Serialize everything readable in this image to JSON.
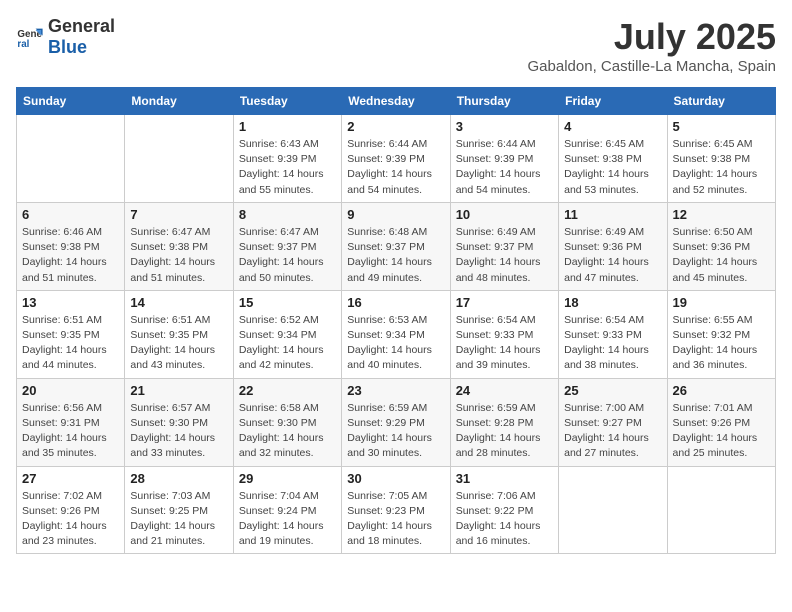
{
  "header": {
    "logo_general": "General",
    "logo_blue": "Blue",
    "month": "July 2025",
    "location": "Gabaldon, Castille-La Mancha, Spain"
  },
  "weekdays": [
    "Sunday",
    "Monday",
    "Tuesday",
    "Wednesday",
    "Thursday",
    "Friday",
    "Saturday"
  ],
  "weeks": [
    [
      {
        "day": "",
        "sunrise": "",
        "sunset": "",
        "daylight": ""
      },
      {
        "day": "",
        "sunrise": "",
        "sunset": "",
        "daylight": ""
      },
      {
        "day": "1",
        "sunrise": "Sunrise: 6:43 AM",
        "sunset": "Sunset: 9:39 PM",
        "daylight": "Daylight: 14 hours and 55 minutes."
      },
      {
        "day": "2",
        "sunrise": "Sunrise: 6:44 AM",
        "sunset": "Sunset: 9:39 PM",
        "daylight": "Daylight: 14 hours and 54 minutes."
      },
      {
        "day": "3",
        "sunrise": "Sunrise: 6:44 AM",
        "sunset": "Sunset: 9:39 PM",
        "daylight": "Daylight: 14 hours and 54 minutes."
      },
      {
        "day": "4",
        "sunrise": "Sunrise: 6:45 AM",
        "sunset": "Sunset: 9:38 PM",
        "daylight": "Daylight: 14 hours and 53 minutes."
      },
      {
        "day": "5",
        "sunrise": "Sunrise: 6:45 AM",
        "sunset": "Sunset: 9:38 PM",
        "daylight": "Daylight: 14 hours and 52 minutes."
      }
    ],
    [
      {
        "day": "6",
        "sunrise": "Sunrise: 6:46 AM",
        "sunset": "Sunset: 9:38 PM",
        "daylight": "Daylight: 14 hours and 51 minutes."
      },
      {
        "day": "7",
        "sunrise": "Sunrise: 6:47 AM",
        "sunset": "Sunset: 9:38 PM",
        "daylight": "Daylight: 14 hours and 51 minutes."
      },
      {
        "day": "8",
        "sunrise": "Sunrise: 6:47 AM",
        "sunset": "Sunset: 9:37 PM",
        "daylight": "Daylight: 14 hours and 50 minutes."
      },
      {
        "day": "9",
        "sunrise": "Sunrise: 6:48 AM",
        "sunset": "Sunset: 9:37 PM",
        "daylight": "Daylight: 14 hours and 49 minutes."
      },
      {
        "day": "10",
        "sunrise": "Sunrise: 6:49 AM",
        "sunset": "Sunset: 9:37 PM",
        "daylight": "Daylight: 14 hours and 48 minutes."
      },
      {
        "day": "11",
        "sunrise": "Sunrise: 6:49 AM",
        "sunset": "Sunset: 9:36 PM",
        "daylight": "Daylight: 14 hours and 47 minutes."
      },
      {
        "day": "12",
        "sunrise": "Sunrise: 6:50 AM",
        "sunset": "Sunset: 9:36 PM",
        "daylight": "Daylight: 14 hours and 45 minutes."
      }
    ],
    [
      {
        "day": "13",
        "sunrise": "Sunrise: 6:51 AM",
        "sunset": "Sunset: 9:35 PM",
        "daylight": "Daylight: 14 hours and 44 minutes."
      },
      {
        "day": "14",
        "sunrise": "Sunrise: 6:51 AM",
        "sunset": "Sunset: 9:35 PM",
        "daylight": "Daylight: 14 hours and 43 minutes."
      },
      {
        "day": "15",
        "sunrise": "Sunrise: 6:52 AM",
        "sunset": "Sunset: 9:34 PM",
        "daylight": "Daylight: 14 hours and 42 minutes."
      },
      {
        "day": "16",
        "sunrise": "Sunrise: 6:53 AM",
        "sunset": "Sunset: 9:34 PM",
        "daylight": "Daylight: 14 hours and 40 minutes."
      },
      {
        "day": "17",
        "sunrise": "Sunrise: 6:54 AM",
        "sunset": "Sunset: 9:33 PM",
        "daylight": "Daylight: 14 hours and 39 minutes."
      },
      {
        "day": "18",
        "sunrise": "Sunrise: 6:54 AM",
        "sunset": "Sunset: 9:33 PM",
        "daylight": "Daylight: 14 hours and 38 minutes."
      },
      {
        "day": "19",
        "sunrise": "Sunrise: 6:55 AM",
        "sunset": "Sunset: 9:32 PM",
        "daylight": "Daylight: 14 hours and 36 minutes."
      }
    ],
    [
      {
        "day": "20",
        "sunrise": "Sunrise: 6:56 AM",
        "sunset": "Sunset: 9:31 PM",
        "daylight": "Daylight: 14 hours and 35 minutes."
      },
      {
        "day": "21",
        "sunrise": "Sunrise: 6:57 AM",
        "sunset": "Sunset: 9:30 PM",
        "daylight": "Daylight: 14 hours and 33 minutes."
      },
      {
        "day": "22",
        "sunrise": "Sunrise: 6:58 AM",
        "sunset": "Sunset: 9:30 PM",
        "daylight": "Daylight: 14 hours and 32 minutes."
      },
      {
        "day": "23",
        "sunrise": "Sunrise: 6:59 AM",
        "sunset": "Sunset: 9:29 PM",
        "daylight": "Daylight: 14 hours and 30 minutes."
      },
      {
        "day": "24",
        "sunrise": "Sunrise: 6:59 AM",
        "sunset": "Sunset: 9:28 PM",
        "daylight": "Daylight: 14 hours and 28 minutes."
      },
      {
        "day": "25",
        "sunrise": "Sunrise: 7:00 AM",
        "sunset": "Sunset: 9:27 PM",
        "daylight": "Daylight: 14 hours and 27 minutes."
      },
      {
        "day": "26",
        "sunrise": "Sunrise: 7:01 AM",
        "sunset": "Sunset: 9:26 PM",
        "daylight": "Daylight: 14 hours and 25 minutes."
      }
    ],
    [
      {
        "day": "27",
        "sunrise": "Sunrise: 7:02 AM",
        "sunset": "Sunset: 9:26 PM",
        "daylight": "Daylight: 14 hours and 23 minutes."
      },
      {
        "day": "28",
        "sunrise": "Sunrise: 7:03 AM",
        "sunset": "Sunset: 9:25 PM",
        "daylight": "Daylight: 14 hours and 21 minutes."
      },
      {
        "day": "29",
        "sunrise": "Sunrise: 7:04 AM",
        "sunset": "Sunset: 9:24 PM",
        "daylight": "Daylight: 14 hours and 19 minutes."
      },
      {
        "day": "30",
        "sunrise": "Sunrise: 7:05 AM",
        "sunset": "Sunset: 9:23 PM",
        "daylight": "Daylight: 14 hours and 18 minutes."
      },
      {
        "day": "31",
        "sunrise": "Sunrise: 7:06 AM",
        "sunset": "Sunset: 9:22 PM",
        "daylight": "Daylight: 14 hours and 16 minutes."
      },
      {
        "day": "",
        "sunrise": "",
        "sunset": "",
        "daylight": ""
      },
      {
        "day": "",
        "sunrise": "",
        "sunset": "",
        "daylight": ""
      }
    ]
  ]
}
